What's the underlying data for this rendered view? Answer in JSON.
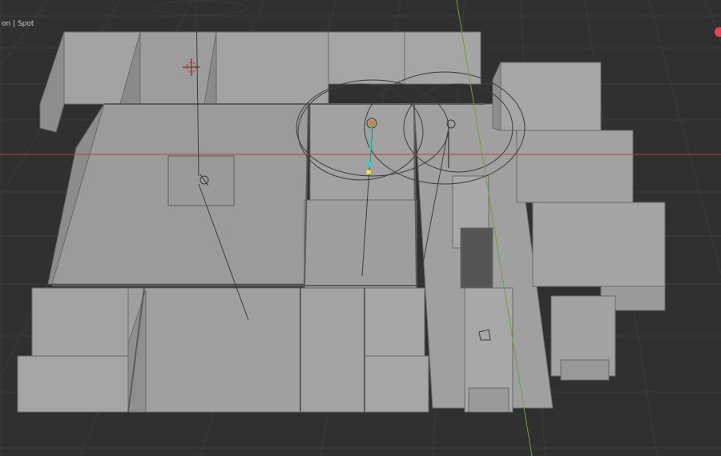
{
  "viewport": {
    "header_text": "on | Spot",
    "background": "#303030",
    "grid_color": "#3a3a3a",
    "x_axis_color": "#c53a3a",
    "y_axis_color": "#6aa52d"
  },
  "scene": {
    "objects": [
      {
        "name": "building-floorplan",
        "type": "mesh",
        "icon": "room-blocks",
        "color": "#9a9a9a"
      },
      {
        "name": "point-light",
        "type": "light",
        "icon": "bulb-icon"
      },
      {
        "name": "spot-light-1",
        "type": "light",
        "icon": "spot-icon"
      },
      {
        "name": "spot-light-2",
        "type": "light",
        "icon": "spot-icon"
      },
      {
        "name": "area-light",
        "type": "light",
        "icon": "area-icon"
      },
      {
        "name": "selected-spot-target",
        "type": "light-handle",
        "color": "#f5e53b"
      },
      {
        "name": "3d-cursor",
        "type": "cursor",
        "icon": "cursor-icon",
        "color": "#e05050"
      }
    ]
  },
  "nav_gizmo": {
    "x_color": "#e64253"
  }
}
